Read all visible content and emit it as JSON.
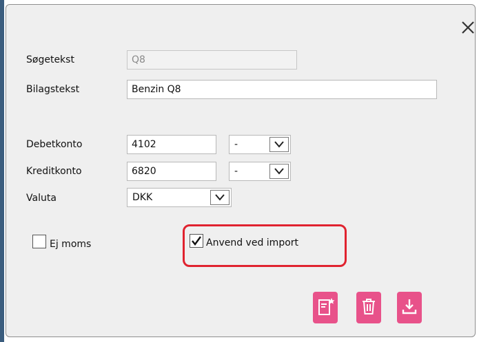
{
  "form": {
    "soegetekst": {
      "label": "Søgetekst",
      "value": "Q8"
    },
    "bilagstekst": {
      "label": "Bilagstekst",
      "value": "Benzin Q8"
    },
    "debetkonto": {
      "label": "Debetkonto",
      "value": "4102",
      "select_value": "-"
    },
    "kreditkonto": {
      "label": "Kreditkonto",
      "value": "6820",
      "select_value": "-"
    },
    "valuta": {
      "label": "Valuta",
      "select_value": "DKK"
    },
    "ej_moms": {
      "label": "Ej moms",
      "checked": false
    },
    "anvend_ved_import": {
      "label": "Anvend ved import",
      "checked": true
    }
  },
  "colors": {
    "accent": "#e8528a",
    "highlight": "#e0232f",
    "dialog_bg": "#efefef"
  },
  "icons": [
    "close-icon",
    "chevron-down-icon",
    "checkmark-icon",
    "new-document-icon",
    "trash-icon",
    "download-icon"
  ]
}
